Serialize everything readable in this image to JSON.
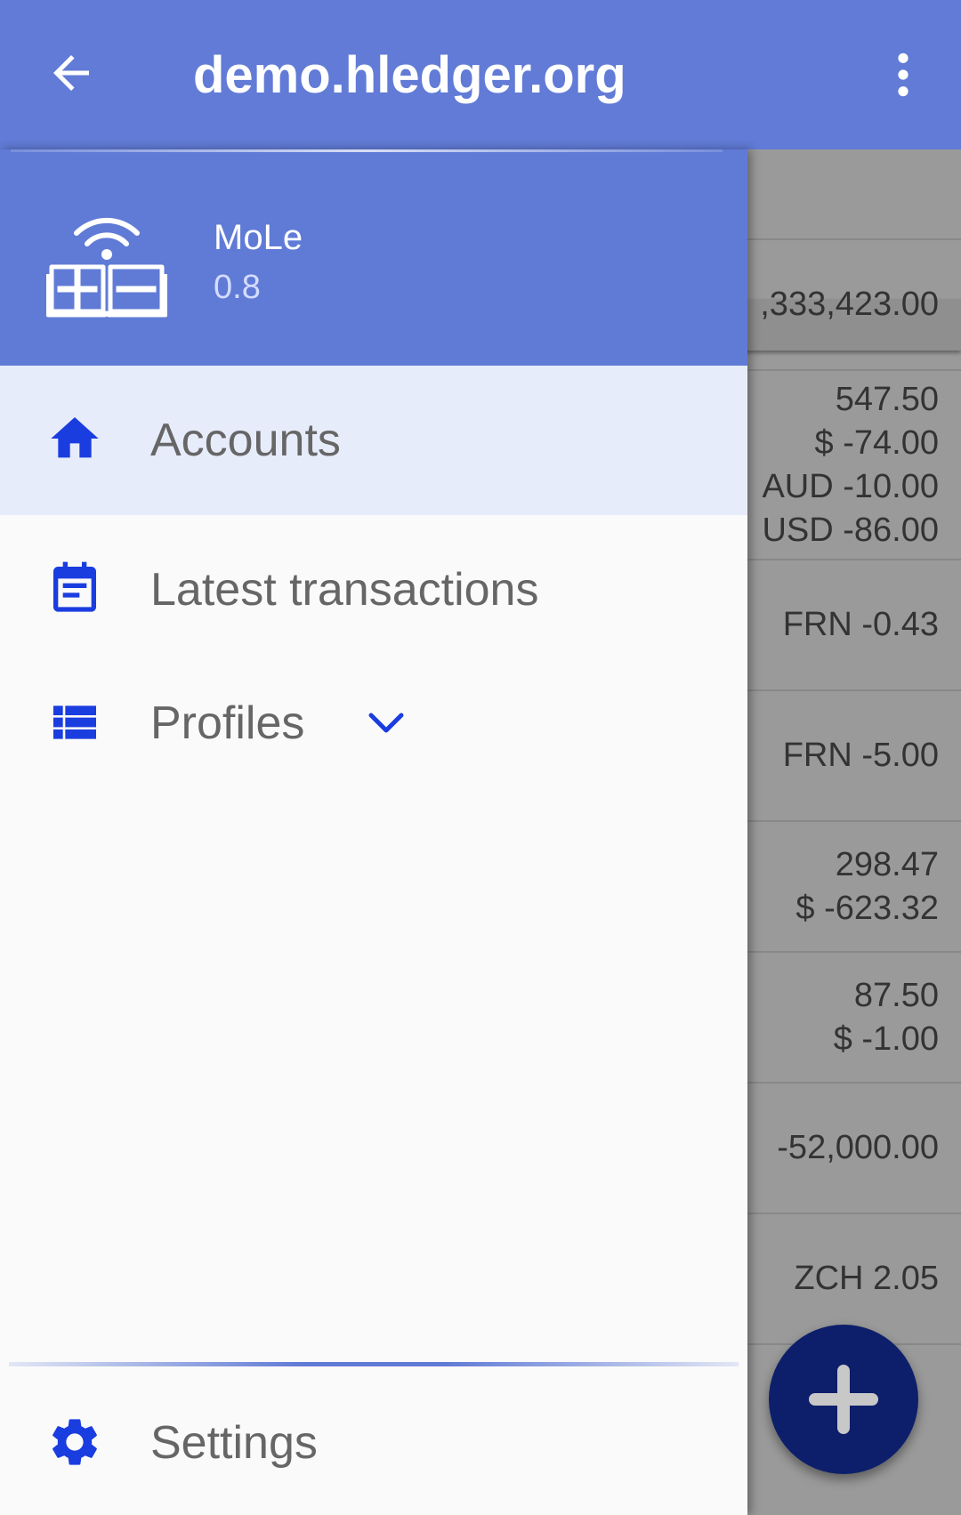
{
  "appbar": {
    "title": "demo.hledger.org",
    "back_icon": "arrow-back-icon",
    "menu_icon": "more-vert-icon",
    "color": "#617bd6"
  },
  "drawer": {
    "header": {
      "app_name": "MoLe",
      "version": "0.8",
      "logo_icon": "mole-logo-icon"
    },
    "items": [
      {
        "label": "Accounts",
        "icon": "home-icon",
        "active": true
      },
      {
        "label": "Latest transactions",
        "icon": "calendar-icon",
        "active": false
      },
      {
        "label": "Profiles",
        "icon": "list-icon",
        "expand_icon": "chevron-down-icon",
        "active": false
      }
    ],
    "footer": {
      "label": "Settings",
      "icon": "gear-icon"
    },
    "accent_color": "#1a3de0"
  },
  "background_list": {
    "rows": [
      {
        "amounts": [
          ",333,423.00"
        ]
      },
      {
        "amounts": [
          "547.50",
          "$ -74.00",
          "AUD -10.00",
          "USD -86.00"
        ]
      },
      {
        "amounts": [
          "FRN -0.43"
        ]
      },
      {
        "amounts": [
          "FRN -5.00"
        ]
      },
      {
        "amounts": [
          "298.47",
          "$ -623.32"
        ]
      },
      {
        "amounts": [
          "87.50",
          "$ -1.00"
        ]
      },
      {
        "amounts": [
          "-52,000.00"
        ]
      },
      {
        "amounts": [
          "ZCH 2.05"
        ]
      }
    ]
  },
  "fab": {
    "icon": "plus-icon",
    "color": "#0d1f6b"
  }
}
